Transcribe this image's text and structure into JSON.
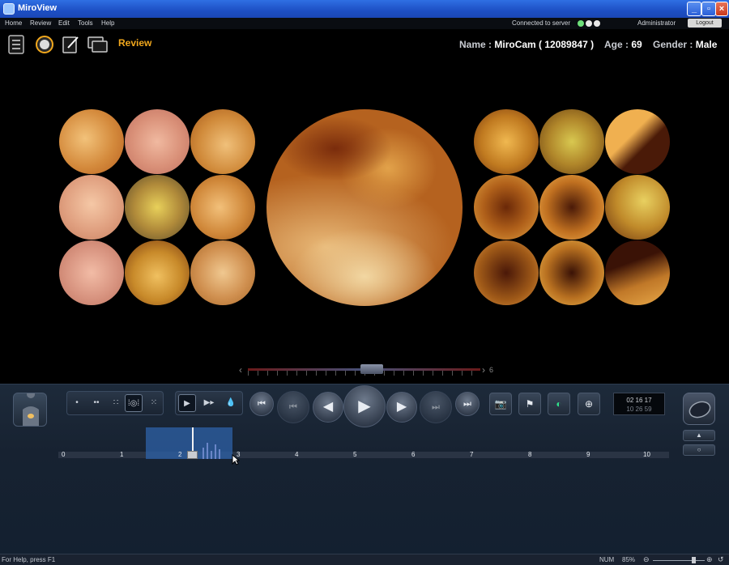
{
  "window": {
    "title": "MiroView"
  },
  "menu": {
    "items": [
      "Home",
      "Review",
      "Edit",
      "Tools",
      "Help"
    ]
  },
  "connection": {
    "text": "Connected to server",
    "status_colors": [
      "#6ee07a",
      "#e8e8e8",
      "#e8e8e8"
    ]
  },
  "user": {
    "name": "Administrator",
    "logout_label": "Logout"
  },
  "toolbar": {
    "icons": [
      "list-icon",
      "record-icon",
      "edit-icon",
      "monitor-icon"
    ],
    "mode_label": "Review"
  },
  "patient": {
    "name_label": "Name :",
    "name_value": "MiroCam ( 12089847 )",
    "age_label": "Age :",
    "age_value": "69",
    "gender_label": "Gender :",
    "gender_value": "Male"
  },
  "scrubber": {
    "end_label": "6",
    "position_fraction": 0.49
  },
  "controls": {
    "view_modes": [
      "1",
      "2",
      "4",
      "1+8",
      "12"
    ],
    "active_view_mode": "1+8",
    "play_modes": [
      "play",
      "fast",
      "drops"
    ],
    "time_primary": "02 16 17",
    "time_secondary": "10 26 59"
  },
  "timeline": {
    "labels": [
      "0",
      "1",
      "2",
      "3",
      "4",
      "5",
      "6",
      "7",
      "8",
      "9",
      "10"
    ],
    "cursor_value": 2.2,
    "selection": [
      1.5,
      3.0
    ]
  },
  "status": {
    "help": "For Help, press F1",
    "num": "NUM",
    "zoom": "85%"
  }
}
